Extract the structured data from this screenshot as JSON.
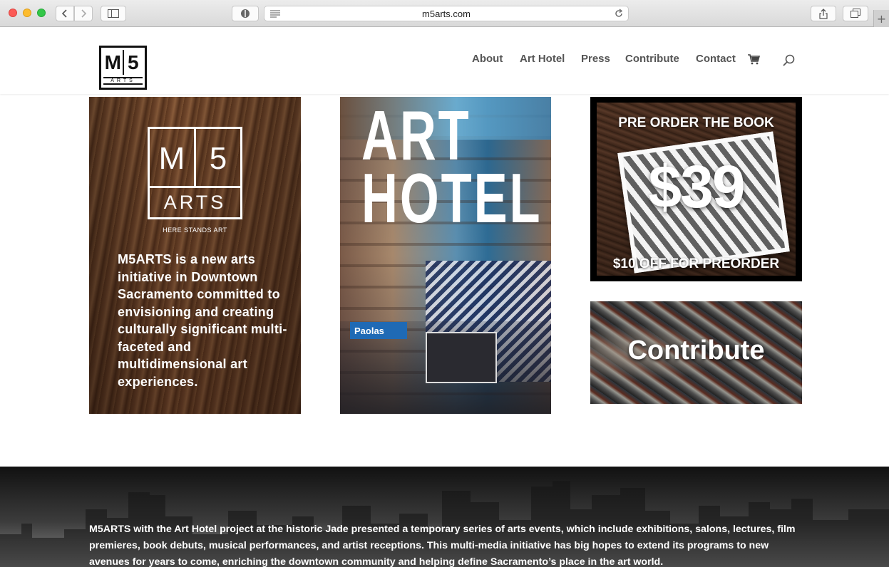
{
  "browser": {
    "url": "m5arts.com"
  },
  "header": {
    "logo": {
      "top": [
        "M",
        "5"
      ],
      "bottom": "ARTS"
    },
    "nav": [
      {
        "label": "About"
      },
      {
        "label": "Art Hotel"
      },
      {
        "label": "Press"
      },
      {
        "label": "Contribute"
      },
      {
        "label": "Contact"
      }
    ]
  },
  "tiles": {
    "about": {
      "logo_top": [
        "M",
        "5"
      ],
      "logo_bottom": "ARTS",
      "tagline": "HERE STANDS ART",
      "text": "M5ARTS is a new arts initiative in Downtown Sacramento committed to envisioning and creating culturally significant multi-faceted and multidimensional art experiences."
    },
    "hotel": {
      "title_line1": "ART",
      "title_line2": "HOTEL",
      "sign": "Paolas"
    },
    "book": {
      "line1": "PRE ORDER THE BOOK",
      "price": "$39",
      "line2": "$10 OFF FOR PREORDER"
    },
    "contribute": {
      "label": "Contribute"
    }
  },
  "band": {
    "text": "M5ARTS with the Art Hotel project at the historic Jade presented a temporary series of arts events, which include exhibitions, salons, lectures, film premieres, book debuts, musical performances, and artist receptions. This multi-media initiative has big hopes to extend its programs to new avenues for years to come, enriching the downtown community and helping define Sacramento’s place in the art world."
  }
}
